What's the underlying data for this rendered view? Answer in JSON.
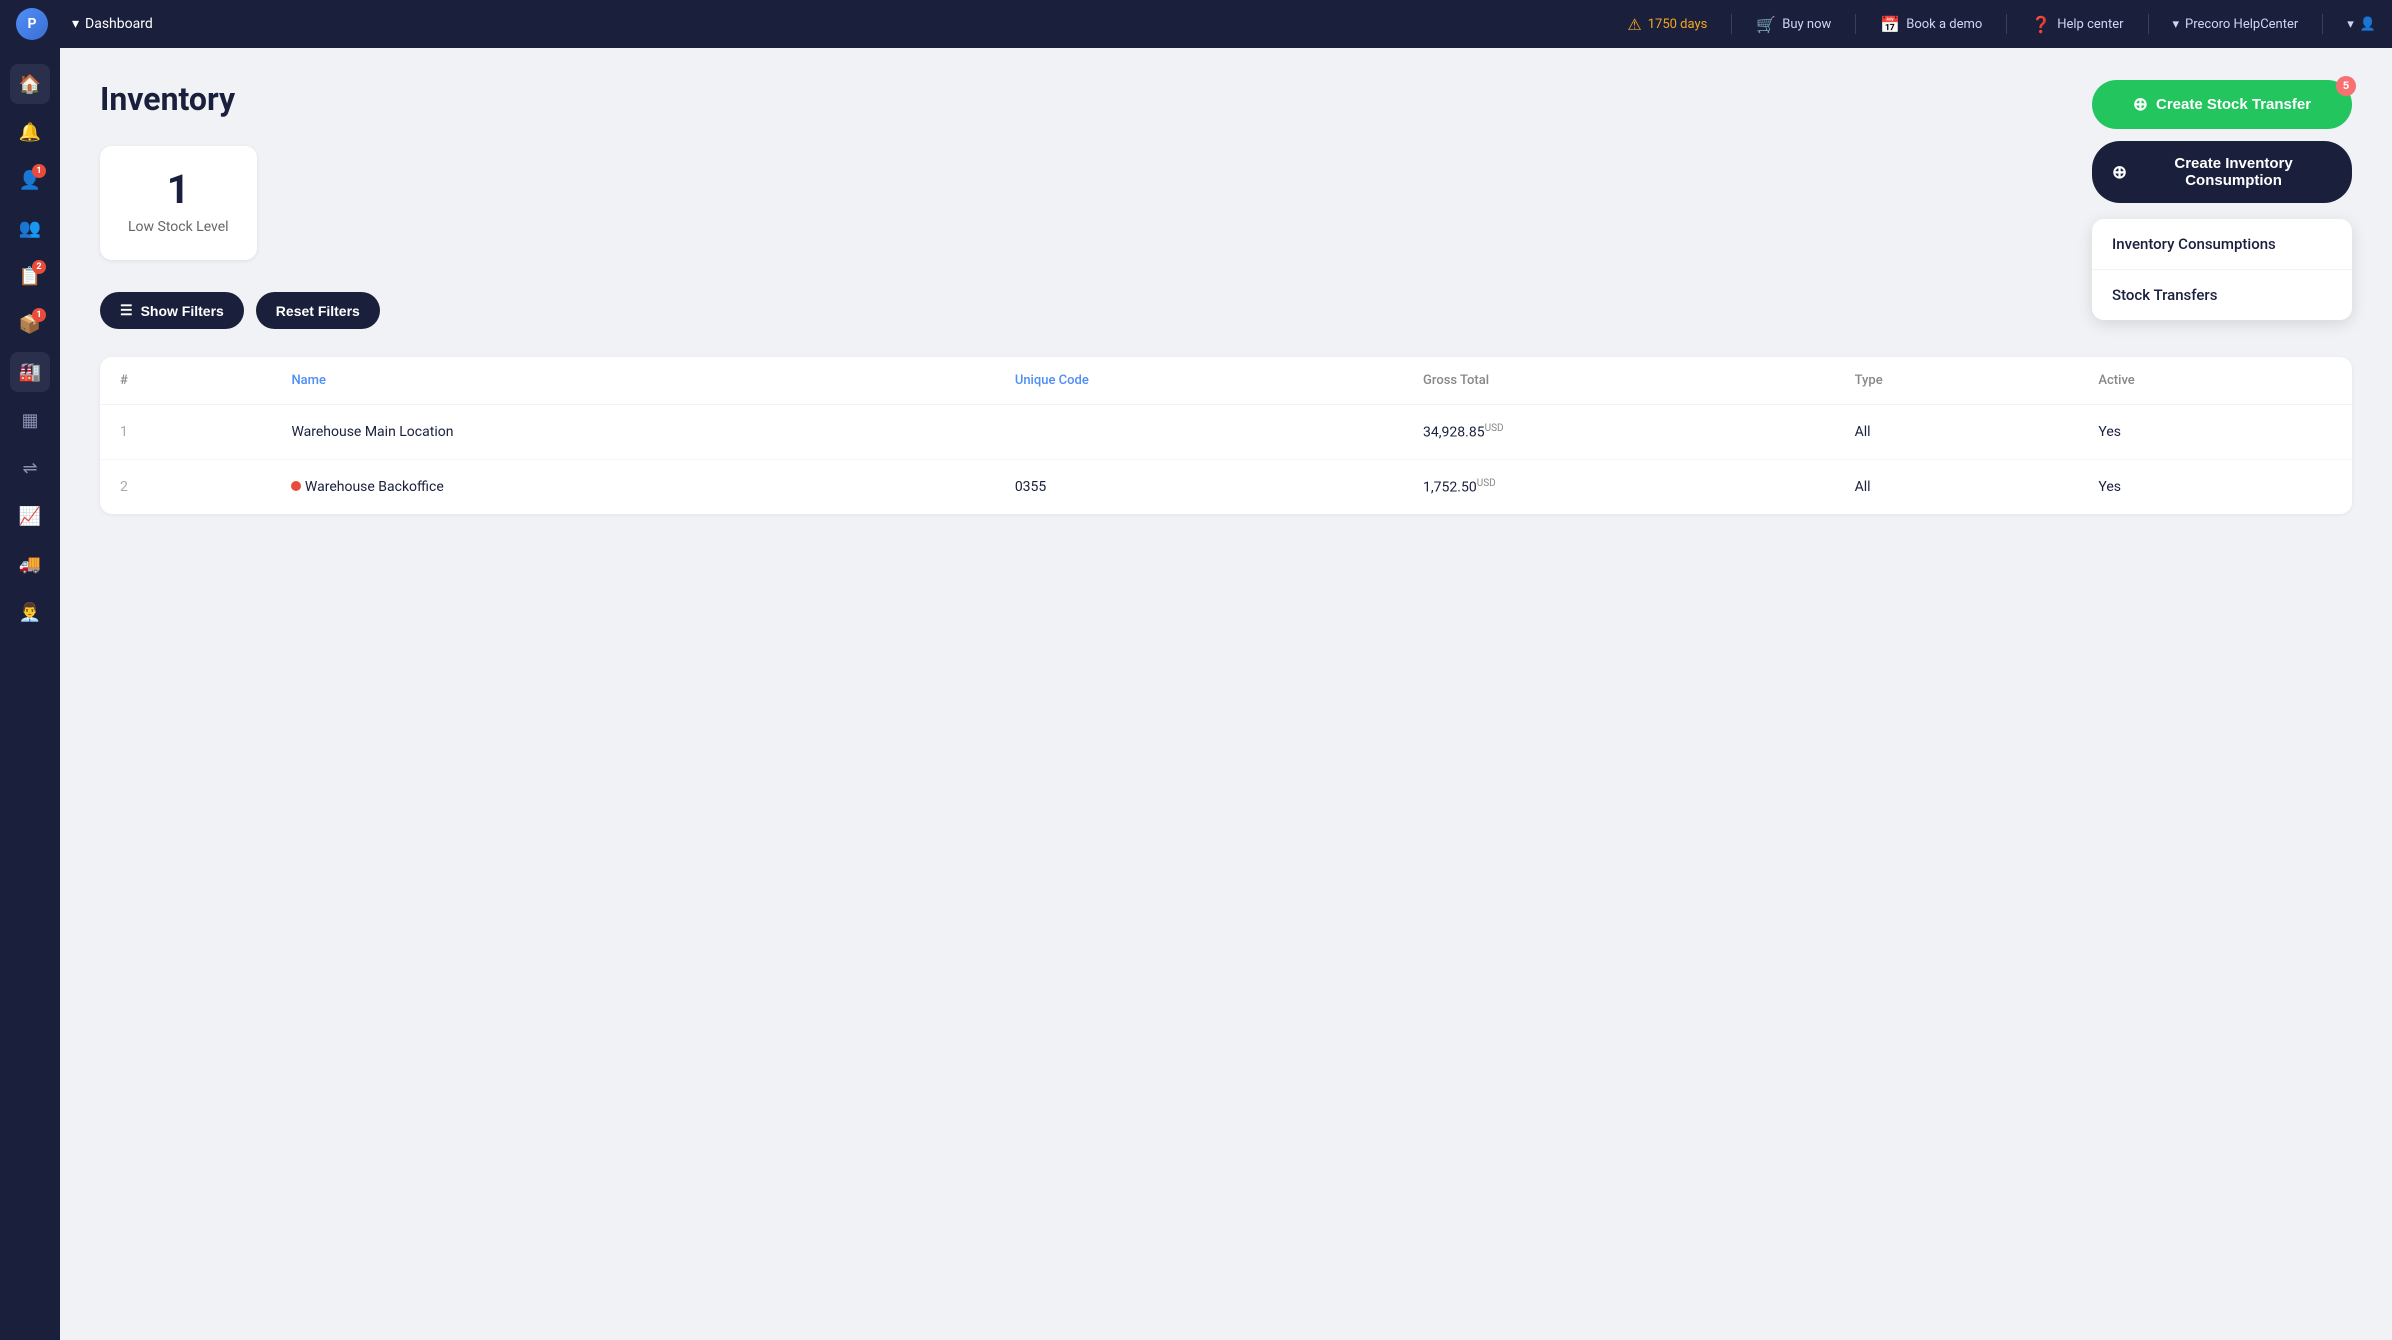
{
  "app": {
    "logo_letter": "P"
  },
  "topnav": {
    "dashboard_label": "Dashboard",
    "warning_days": "1750 days",
    "buy_now": "Buy now",
    "book_demo": "Book a demo",
    "help_center": "Help center",
    "org_label": "Precoro HelpCenter"
  },
  "sidebar": {
    "icons": [
      {
        "name": "home-icon",
        "symbol": "⌂"
      },
      {
        "name": "bell-icon",
        "symbol": "🔔",
        "badge": null
      },
      {
        "name": "users-icon",
        "symbol": "👤",
        "badge": "1"
      },
      {
        "name": "team-icon",
        "symbol": "👥"
      },
      {
        "name": "orders-icon",
        "symbol": "📋",
        "badge": "2"
      },
      {
        "name": "box-icon",
        "symbol": "📦",
        "badge": null
      },
      {
        "name": "warehouse-icon",
        "symbol": "🏭"
      },
      {
        "name": "table-icon",
        "symbol": "▦"
      },
      {
        "name": "transfers-icon",
        "symbol": "⇌"
      },
      {
        "name": "chart-icon",
        "symbol": "📈"
      },
      {
        "name": "truck-icon",
        "symbol": "🚚"
      },
      {
        "name": "contacts-icon",
        "symbol": "👨‍💼"
      }
    ]
  },
  "page": {
    "title": "Inventory"
  },
  "stats": {
    "low_stock": {
      "value": "1",
      "label": "Low Stock Level"
    }
  },
  "buttons": {
    "create_stock_transfer": "Create Stock Transfer",
    "create_inventory_consumption": "Create Inventory Consumption",
    "inventory_consumptions": "Inventory Consumptions",
    "stock_transfers": "Stock Transfers",
    "show_filters": "Show Filters",
    "reset_filters": "Reset Filters",
    "badge_5": "5"
  },
  "table": {
    "columns": [
      {
        "key": "num",
        "label": "#",
        "sortable": false
      },
      {
        "key": "name",
        "label": "Name",
        "sortable": true
      },
      {
        "key": "unique_code",
        "label": "Unique Code",
        "sortable": true
      },
      {
        "key": "gross_total",
        "label": "Gross Total",
        "sortable": false
      },
      {
        "key": "type",
        "label": "Type",
        "sortable": false
      },
      {
        "key": "active",
        "label": "Active",
        "sortable": false
      }
    ],
    "rows": [
      {
        "num": "1",
        "name": "Warehouse Main Location",
        "unique_code": "",
        "gross_total": "34,928.85",
        "gross_total_currency": "USD",
        "type": "All",
        "active": "Yes",
        "has_dot": false
      },
      {
        "num": "2",
        "name": "Warehouse Backoffice",
        "unique_code": "0355",
        "gross_total": "1,752.50",
        "gross_total_currency": "USD",
        "type": "All",
        "active": "Yes",
        "has_dot": true
      }
    ]
  }
}
